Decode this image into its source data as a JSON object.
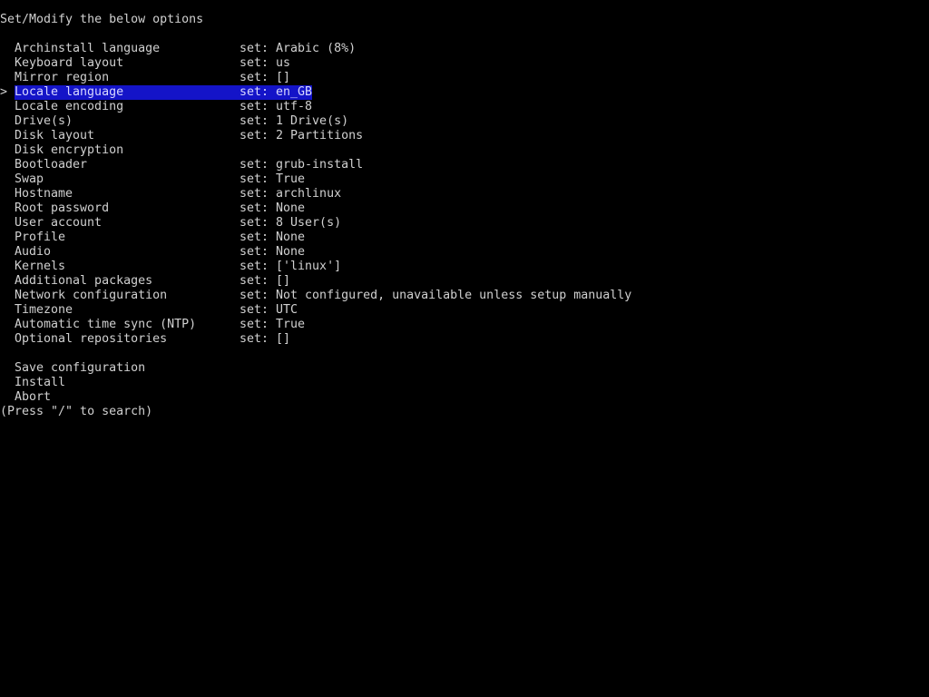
{
  "header": {
    "title": "Set/Modify the below options"
  },
  "cursor_glyph": ">",
  "colors": {
    "background": "#000000",
    "text": "#d0d0d0",
    "highlight": "#1414c8"
  },
  "menu": {
    "selected_index": 3,
    "items": [
      {
        "label": "Archinstall language",
        "value": "set: Arabic (8%)"
      },
      {
        "label": "Keyboard layout",
        "value": "set: us"
      },
      {
        "label": "Mirror region",
        "value": "set: []"
      },
      {
        "label": "Locale language",
        "value": "set: en_GB"
      },
      {
        "label": "Locale encoding",
        "value": "set: utf-8"
      },
      {
        "label": "Drive(s)",
        "value": "set: 1 Drive(s)"
      },
      {
        "label": "Disk layout",
        "value": "set: 2 Partitions"
      },
      {
        "label": "Disk encryption",
        "value": ""
      },
      {
        "label": "Bootloader",
        "value": "set: grub-install"
      },
      {
        "label": "Swap",
        "value": "set: True"
      },
      {
        "label": "Hostname",
        "value": "set: archlinux"
      },
      {
        "label": "Root password",
        "value": "set: None"
      },
      {
        "label": "User account",
        "value": "set: 8 User(s)"
      },
      {
        "label": "Profile",
        "value": "set: None"
      },
      {
        "label": "Audio",
        "value": "set: None"
      },
      {
        "label": "Kernels",
        "value": "set: ['linux']"
      },
      {
        "label": "Additional packages",
        "value": "set: []"
      },
      {
        "label": "Network configuration",
        "value": "set: Not configured, unavailable unless setup manually"
      },
      {
        "label": "Timezone",
        "value": "set: UTC"
      },
      {
        "label": "Automatic time sync (NTP)",
        "value": "set: True"
      },
      {
        "label": "Optional repositories",
        "value": "set: []"
      }
    ],
    "actions": [
      {
        "label": "Save configuration"
      },
      {
        "label": "Install"
      },
      {
        "label": "Abort"
      }
    ]
  },
  "footer": {
    "hint": "(Press \"/\" to search)"
  }
}
